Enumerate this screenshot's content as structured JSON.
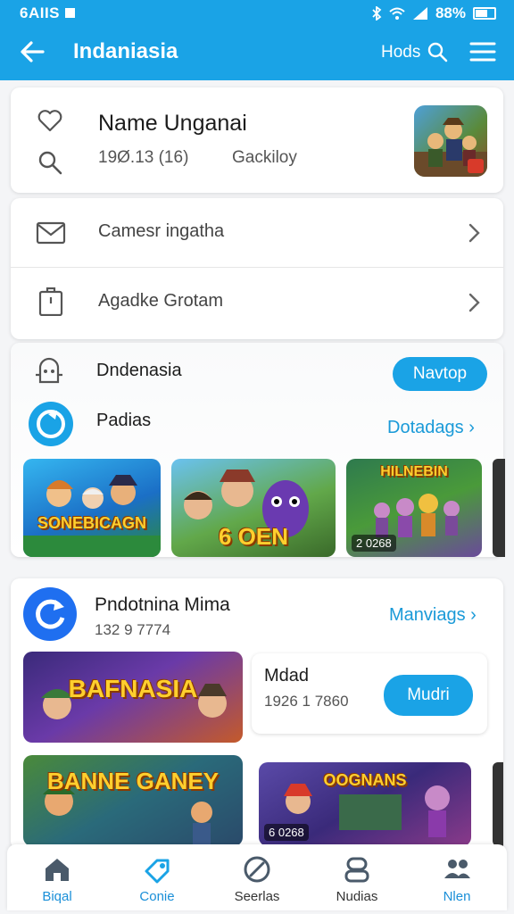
{
  "status_bar": {
    "left_text": "6AIIS",
    "battery_text": "88%"
  },
  "app_bar": {
    "title": "Indaniasia",
    "search_label": "Hods"
  },
  "profile": {
    "name": "Name Unganai",
    "stat": "19Ø.13 (16)",
    "tag": "Gackiloy"
  },
  "menu": {
    "items": [
      {
        "label": "Camesr ingatha",
        "icon": "mail-icon"
      },
      {
        "label": "Agadke Grotam",
        "icon": "clipboard-icon"
      }
    ]
  },
  "games": {
    "section_label": "Dndenasia",
    "action_button": "Navtop",
    "subsection_label": "Padias",
    "link": "Dotadags",
    "tiles": [
      {
        "caption": "SONEBICAGN",
        "meta": ""
      },
      {
        "caption": "6 OEN",
        "meta": ""
      },
      {
        "caption": "HILNEBIN",
        "meta": "2 0268"
      }
    ]
  },
  "news": {
    "title": "Pndotnina Mima",
    "count": "132 9 7774",
    "link": "Manviags",
    "feature": {
      "caption": "BAFNASIA"
    },
    "mini": {
      "title": "Mdad",
      "count": "1926 1 7860",
      "button": "Mudri"
    },
    "tiles": [
      {
        "caption": "BANNE GANEY",
        "meta": ""
      },
      {
        "caption": "OOGNANS",
        "meta": "6 0268"
      }
    ]
  },
  "bottom_nav": [
    {
      "label": "Biqal",
      "icon": "home-icon"
    },
    {
      "label": "Conie",
      "icon": "tag-icon"
    },
    {
      "label": "Seerlas",
      "icon": "compass-icon"
    },
    {
      "label": "Nudias",
      "icon": "person-icon"
    },
    {
      "label": "Nlen",
      "icon": "people-icon"
    }
  ],
  "colors": {
    "primary": "#1aa3e6",
    "link": "#1a9ad8",
    "accent_dark": "#1f6ff0"
  }
}
